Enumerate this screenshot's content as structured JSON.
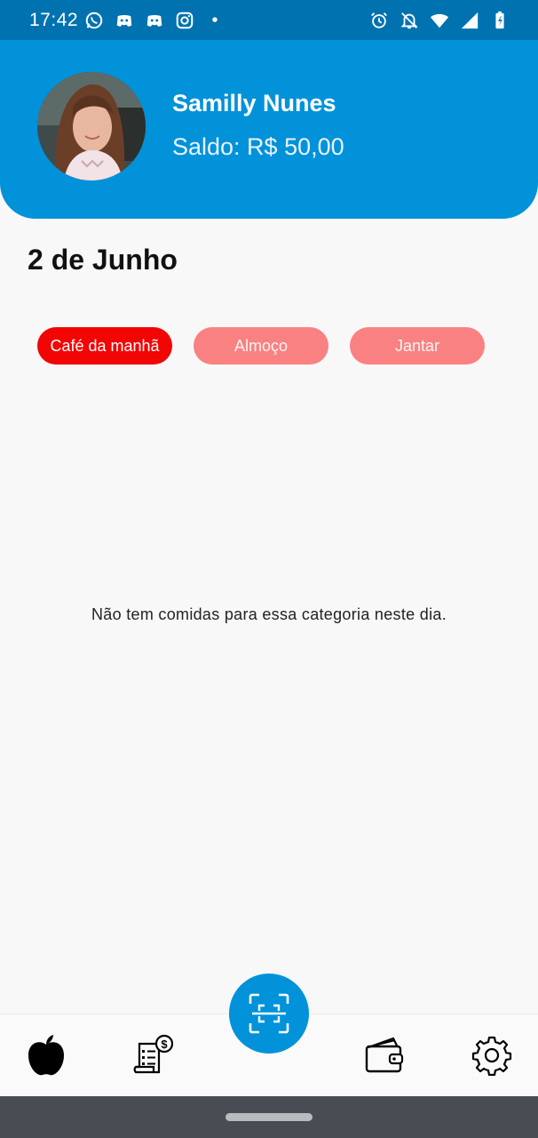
{
  "status_bar": {
    "time": "17:42",
    "left_icons": [
      "whatsapp-icon",
      "discord-icon",
      "discord-icon",
      "instagram-icon",
      "dot-icon"
    ],
    "right_icons": [
      "alarm-icon",
      "notifications-off-icon",
      "wifi-icon",
      "signal-icon",
      "battery-icon"
    ]
  },
  "profile": {
    "name": "Samilly Nunes",
    "balance": "Saldo: R$ 50,00"
  },
  "date_title": "2 de Junho",
  "meal_tabs": [
    {
      "label": "Café da manhã",
      "active": true
    },
    {
      "label": "Almoço",
      "active": false
    },
    {
      "label": "Jantar",
      "active": false
    }
  ],
  "empty_message": "Não tem comidas para essa categoria neste dia.",
  "bottom_nav": {
    "items": [
      "apple-icon",
      "receipt-money-icon",
      "qr-scan-icon",
      "wallet-icon",
      "gear-icon"
    ]
  },
  "colors": {
    "header": "#0292da",
    "status_bar": "#0072b0",
    "tab_active": "#f20505",
    "tab_inactive": "#fa8181"
  }
}
